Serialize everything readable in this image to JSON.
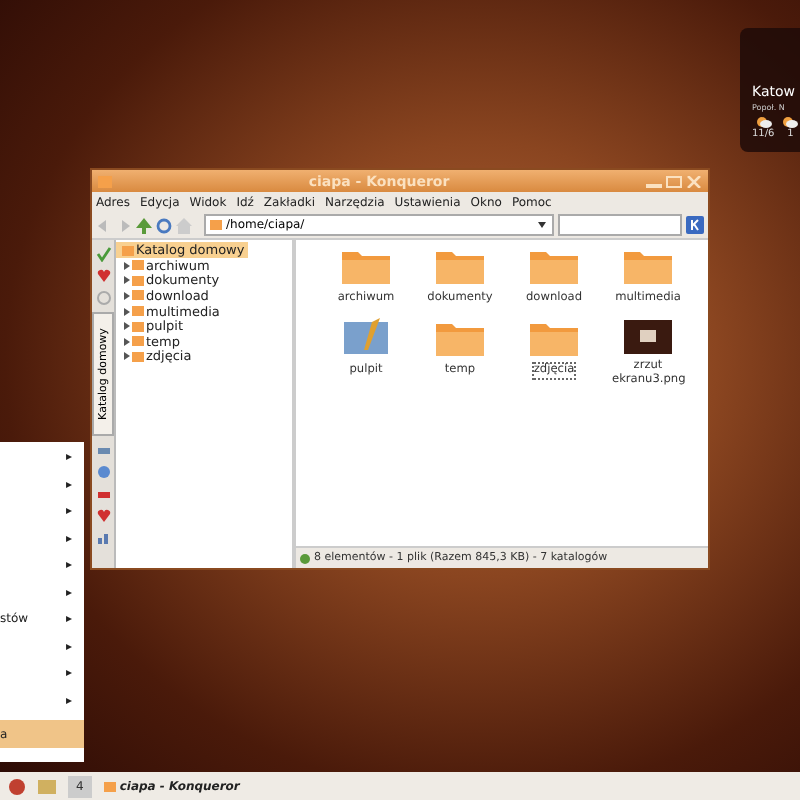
{
  "window": {
    "title": "ciapa - Konqueror"
  },
  "menu_bar": [
    "Adres",
    "Edycja",
    "Widok",
    "Idź",
    "Zakładki",
    "Narzędzia",
    "Ustawienia",
    "Okno",
    "Pomoc"
  ],
  "location": {
    "value": "/home/ciapa/"
  },
  "sidebar": {
    "tab_label": "Katalog domowy",
    "root": {
      "label": "Katalog domowy",
      "selected": true,
      "children": [
        {
          "label": "archiwum",
          "expanded": false
        },
        {
          "label": "dokumenty",
          "expanded": false
        },
        {
          "label": "download",
          "expanded": false
        },
        {
          "label": "multimedia",
          "expanded": false
        },
        {
          "label": "pulpit",
          "expanded": false
        },
        {
          "label": "temp",
          "expanded": false
        },
        {
          "label": "zdjęcia",
          "expanded": false
        }
      ]
    }
  },
  "files": [
    {
      "name": "archiwum",
      "kind": "folder",
      "selected": false
    },
    {
      "name": "dokumenty",
      "kind": "folder",
      "selected": false
    },
    {
      "name": "download",
      "kind": "folder",
      "selected": false
    },
    {
      "name": "multimedia",
      "kind": "folder",
      "selected": false
    },
    {
      "name": "pulpit",
      "kind": "desktop",
      "selected": false
    },
    {
      "name": "temp",
      "kind": "folder",
      "selected": false
    },
    {
      "name": "zdjęcia",
      "kind": "folder",
      "selected": true
    },
    {
      "name": "zrzut ekranu3.png",
      "kind": "image",
      "selected": false
    }
  ],
  "status_bar": "8 elementów - 1 plik (Razem 845,3 KB) - 7 katalogów",
  "start_menu": {
    "items": [
      {
        "arrow": "▸",
        "selected": false
      },
      {
        "arrow": "▸",
        "selected": false
      },
      {
        "arrow": "▸",
        "selected": false
      },
      {
        "arrow": "▸",
        "selected": false
      },
      {
        "arrow": "▸",
        "selected": false
      },
      {
        "arrow": "▸",
        "selected": false
      },
      {
        "label": "stów",
        "arrow": "▸",
        "selected": false
      },
      {
        "arrow": "▸",
        "selected": false
      },
      {
        "arrow": "▸",
        "selected": false
      },
      {
        "arrow": "▸",
        "selected": false
      },
      {
        "label": "a",
        "selected": true
      }
    ]
  },
  "weather": {
    "city": "Katow",
    "condition": "Popoł. N",
    "days": [
      {
        "temp": "11/6"
      },
      {
        "temp": "1"
      }
    ]
  },
  "taskbar": {
    "desktop_number": "4",
    "tasks": [
      {
        "title": "ciapa - Konqueror",
        "selected": false
      }
    ]
  }
}
